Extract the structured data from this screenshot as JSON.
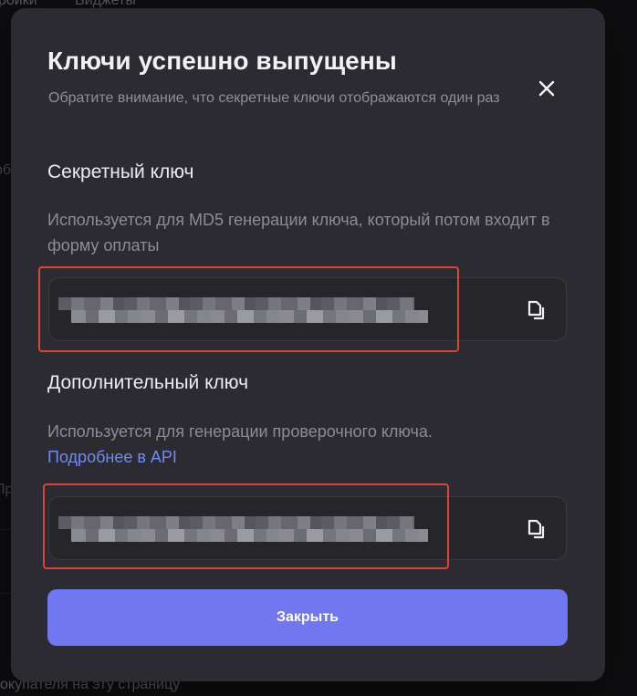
{
  "background": {
    "tabs": [
      "ройки",
      "Виджеты"
    ],
    "fragments": [
      "об",
      "Пр",
      "окупателя на эту страницу"
    ]
  },
  "modal": {
    "title": "Ключи успешно выпущены",
    "subtitle": "Обратите внимание, что секретные ключи отображаются один раз",
    "close_icon": "close-icon"
  },
  "secret_key": {
    "title": "Секретный ключ",
    "description": "Используется для MD5 генерации ключа, который потом входит в форму оплаты",
    "value_state": "blurred",
    "copy_icon": "copy-icon"
  },
  "additional_key": {
    "title": "Дополнительный ключ",
    "description": "Используется для генерации проверочного ключа.",
    "link": "Подробнее в API",
    "value_state": "blurred",
    "copy_icon": "copy-icon"
  },
  "actions": {
    "close_label": "Закрыть"
  },
  "colors": {
    "modal_bg": "#2b2b31",
    "accent": "#7077f0",
    "link": "#6f8cf5",
    "highlight": "#d9453e"
  }
}
